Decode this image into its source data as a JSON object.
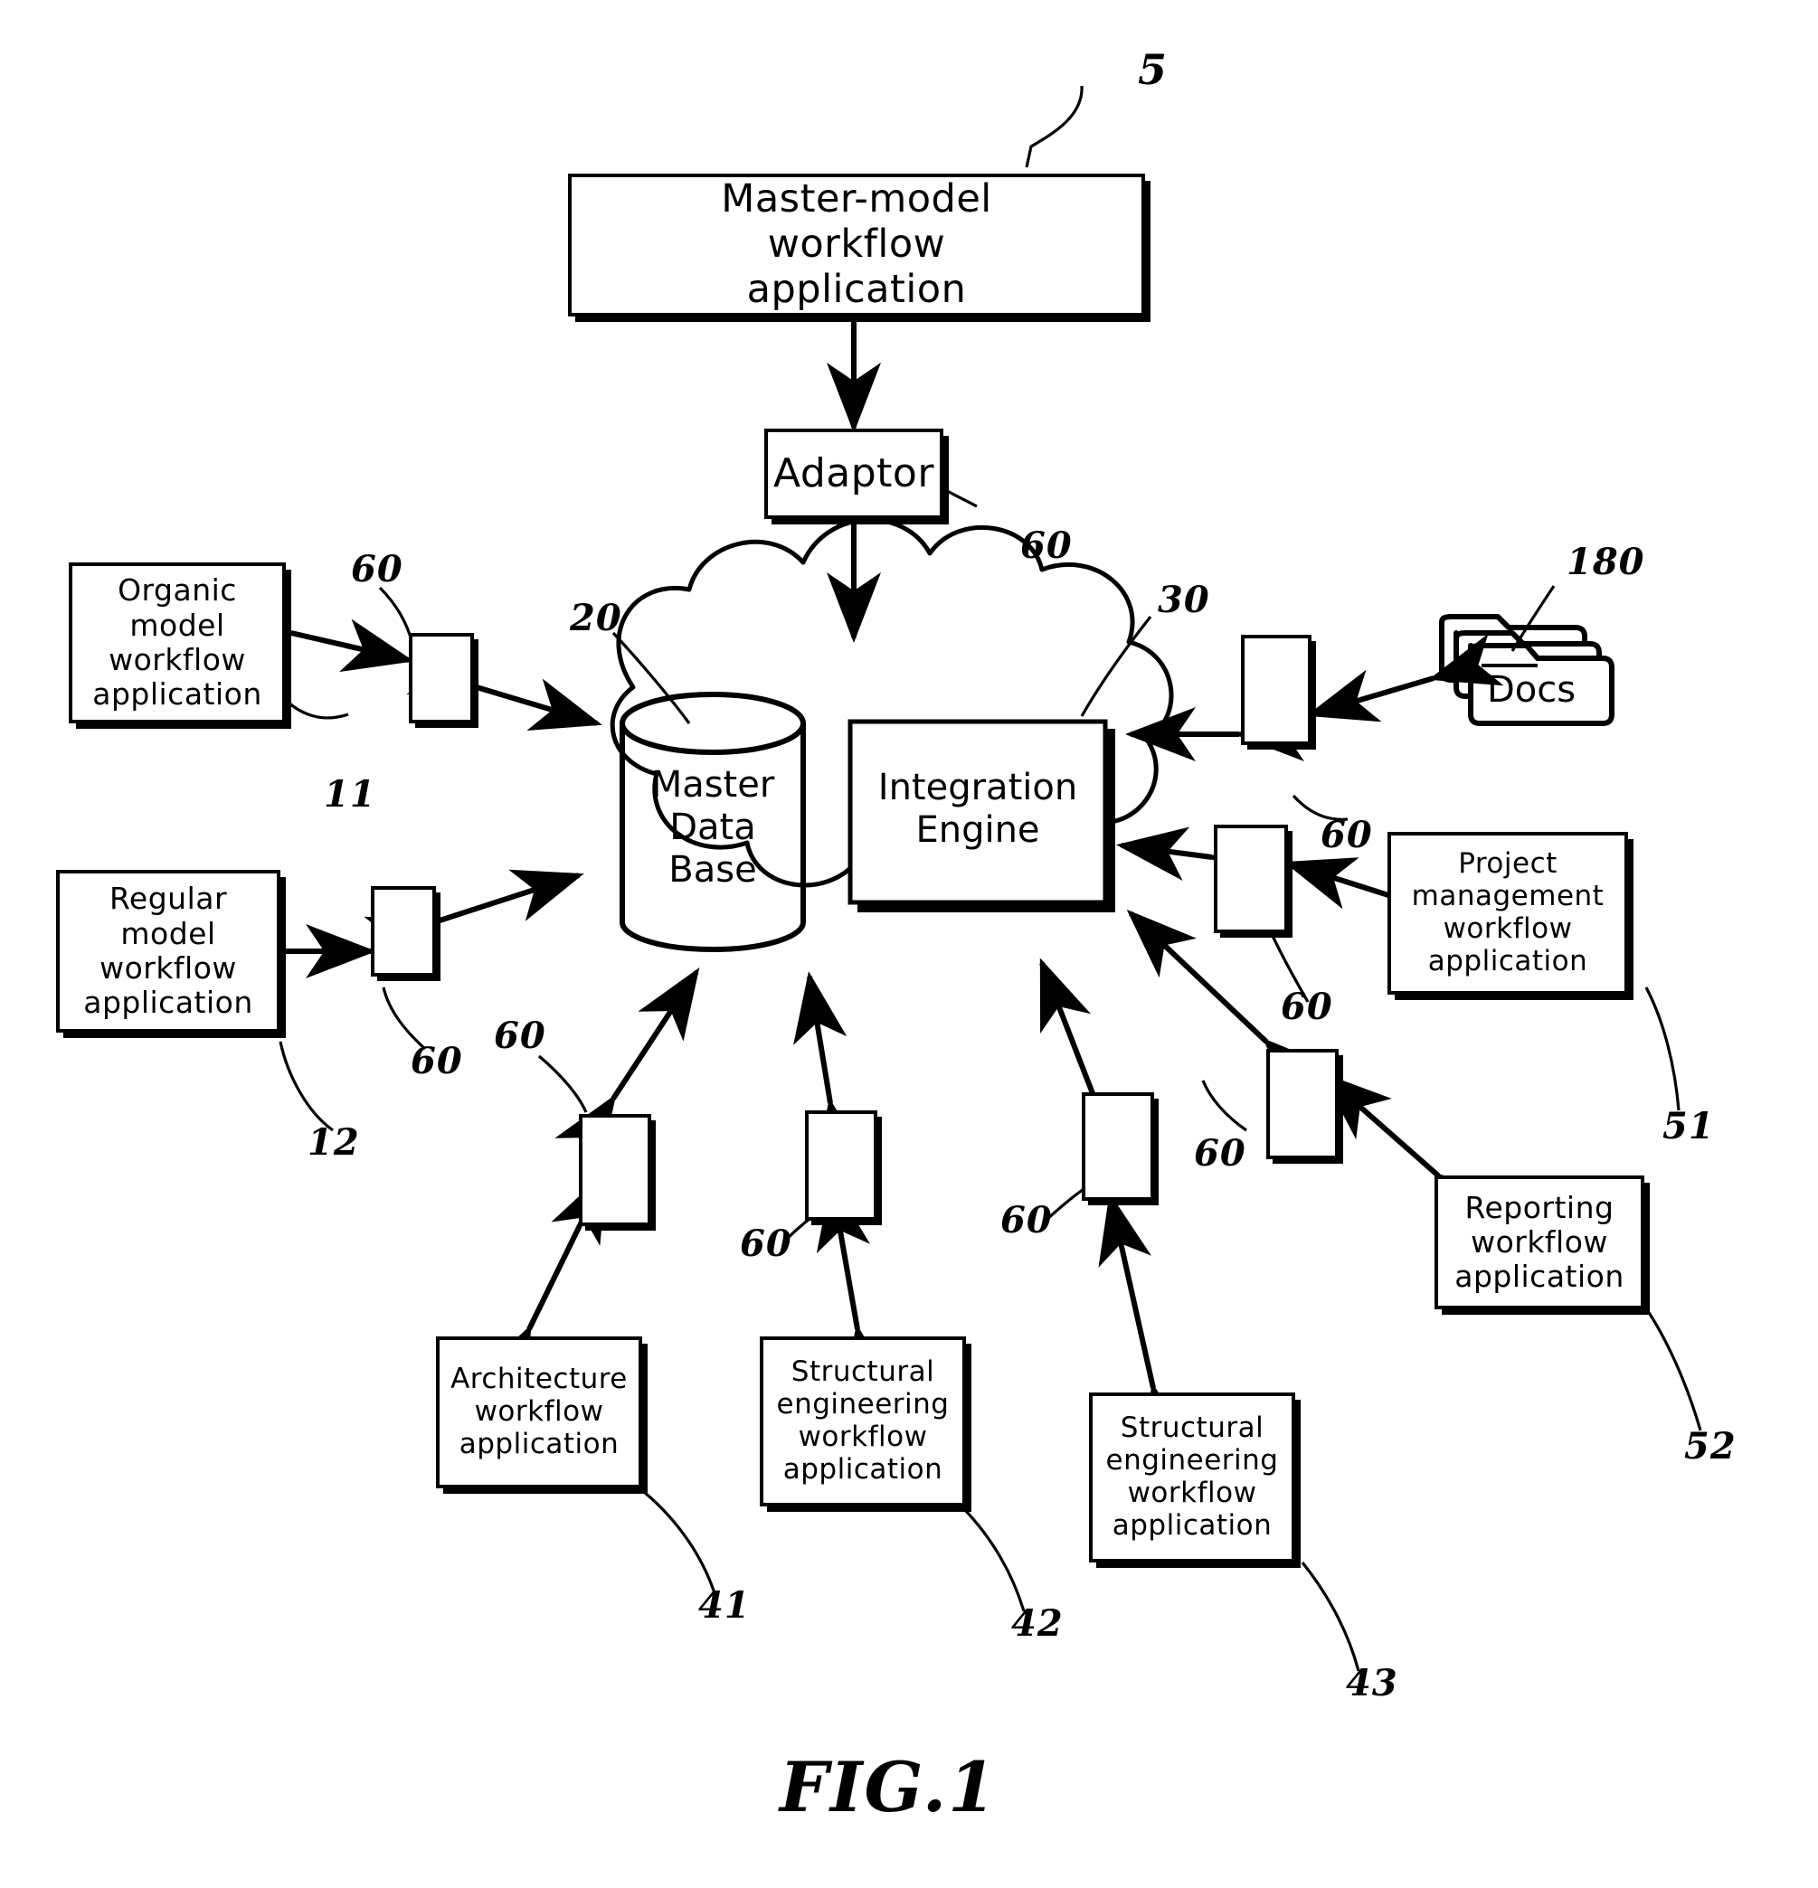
{
  "figure": {
    "caption": "FIG.1"
  },
  "nodes": {
    "master_model": {
      "label": "Master-model\nworkflow\napplication",
      "ref": "5"
    },
    "adaptor": {
      "label": "Adaptor",
      "ref": "60"
    },
    "cloud": {
      "ref": "20"
    },
    "master_database": {
      "label": "Master\nData\nBase"
    },
    "integration_engine": {
      "label": "Integration\nEngine",
      "ref": "30"
    },
    "docs": {
      "label": "Docs",
      "ref": "180"
    },
    "organic_model": {
      "label": "Organic\nmodel\nworkflow\napplication",
      "ref": "11"
    },
    "regular_model": {
      "label": "Regular\nmodel\nworkflow\napplication",
      "ref": "12"
    },
    "project_management": {
      "label": "Project\nmanagement\nworkflow\napplication",
      "ref": "51"
    },
    "reporting": {
      "label": "Reporting\nworkflow\napplication",
      "ref": "52"
    },
    "architecture": {
      "label": "Architecture\nworkflow\napplication",
      "ref": "41"
    },
    "structural_1": {
      "label": "Structural\nengineering\nworkflow\napplication",
      "ref": "42"
    },
    "structural_2": {
      "label": "Structural\nengineering\nworkflow\napplication",
      "ref": "43"
    }
  },
  "adaptor_refs": {
    "organic": "60",
    "regular": "60",
    "docs": "60",
    "project": "60",
    "reporting": "60",
    "architecture": "60",
    "structural_1": "60",
    "structural_2": "60",
    "top": "60"
  },
  "colors": {
    "ink": "#000000",
    "paper": "#ffffff"
  },
  "chart_data": {
    "type": "diagram",
    "title": "FIG.1",
    "description": "Master-model workflow architecture: a central cloud (20) containing a Master Data Base and an Integration Engine (30) connected through Adaptors (60) to peripheral workflow applications.",
    "center": [
      "Master Data Base",
      "Integration Engine"
    ],
    "connections": [
      {
        "from": "Master-model workflow application",
        "via": "Adaptor",
        "to": "cloud",
        "arrow": "both"
      },
      {
        "from": "Organic model workflow application",
        "via": "60",
        "to": "cloud",
        "arrow": "both"
      },
      {
        "from": "Regular model workflow application",
        "via": "60",
        "to": "cloud",
        "arrow": "both"
      },
      {
        "from": "Docs",
        "via": "60",
        "to": "cloud",
        "arrow": "both"
      },
      {
        "from": "Project management workflow application",
        "via": "60",
        "to": "cloud",
        "arrow": "both"
      },
      {
        "from": "Reporting workflow application",
        "via": "60",
        "to": "cloud",
        "arrow": "both"
      },
      {
        "from": "Architecture workflow application",
        "via": "60",
        "to": "cloud",
        "arrow": "both"
      },
      {
        "from": "Structural engineering workflow application (42)",
        "via": "60",
        "to": "cloud",
        "arrow": "both"
      },
      {
        "from": "Structural engineering workflow application (43)",
        "via": "60",
        "to": "cloud",
        "arrow": "both"
      }
    ]
  }
}
